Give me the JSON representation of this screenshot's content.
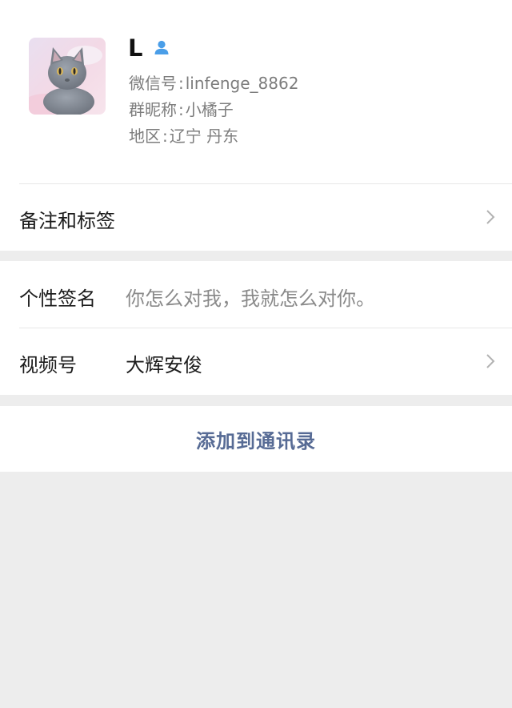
{
  "profile": {
    "name": "L",
    "gender_icon": "male-user-icon",
    "wechat_id_label": "微信号",
    "wechat_id_value": "linfenge_8862",
    "group_nickname_label": "群昵称",
    "group_nickname_value": "小橘子",
    "region_label": "地区",
    "region_value": "辽宁 丹东",
    "avatar_description": "gray cat photo"
  },
  "rows": {
    "remark_label": "备注和标签",
    "signature_label": "个性签名",
    "signature_value": "你怎么对我，我就怎么对你。",
    "channels_label": "视频号",
    "channels_value": "大辉安俊"
  },
  "actions": {
    "add_contact_label": "添加到通讯录"
  },
  "colors": {
    "link_blue": "#576b95",
    "gender_blue": "#4a9ee8",
    "background_gray": "#ededed"
  }
}
